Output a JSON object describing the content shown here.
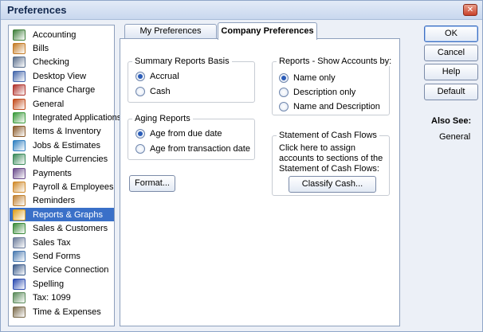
{
  "window": {
    "title": "Preferences",
    "close_label": "✕"
  },
  "categories": [
    {
      "label": "Accounting",
      "icon": "accounting-icon",
      "color": "#3f7f3a"
    },
    {
      "label": "Bills",
      "icon": "bills-icon",
      "color": "#c47b25"
    },
    {
      "label": "Checking",
      "icon": "checking-icon",
      "color": "#5a6f8c"
    },
    {
      "label": "Desktop View",
      "icon": "desktop-view-icon",
      "color": "#4466aa"
    },
    {
      "label": "Finance Charge",
      "icon": "finance-charge-icon",
      "color": "#b0322b"
    },
    {
      "label": "General",
      "icon": "general-icon",
      "color": "#c24a1a"
    },
    {
      "label": "Integrated Applications",
      "icon": "integrated-apps-icon",
      "color": "#3a9a3a"
    },
    {
      "label": "Items & Inventory",
      "icon": "items-inventory-icon",
      "color": "#8a5a2a"
    },
    {
      "label": "Jobs & Estimates",
      "icon": "jobs-estimates-icon",
      "color": "#2f7fc0"
    },
    {
      "label": "Multiple Currencies",
      "icon": "currencies-icon",
      "color": "#3a8a5a"
    },
    {
      "label": "Payments",
      "icon": "payments-icon",
      "color": "#6a4a8a"
    },
    {
      "label": "Payroll & Employees",
      "icon": "payroll-icon",
      "color": "#d08a2a"
    },
    {
      "label": "Reminders",
      "icon": "reminders-icon",
      "color": "#c08030"
    },
    {
      "label": "Reports & Graphs",
      "icon": "reports-graphs-icon",
      "color": "#e0a020",
      "selected": true
    },
    {
      "label": "Sales & Customers",
      "icon": "sales-customers-icon",
      "color": "#3a8a3a"
    },
    {
      "label": "Sales Tax",
      "icon": "sales-tax-icon",
      "color": "#6a7a9a"
    },
    {
      "label": "Send Forms",
      "icon": "send-forms-icon",
      "color": "#4a7ab0"
    },
    {
      "label": "Service Connection",
      "icon": "service-connection-icon",
      "color": "#3a5a8a"
    },
    {
      "label": "Spelling",
      "icon": "spelling-icon",
      "color": "#2a4ab0"
    },
    {
      "label": "Tax: 1099",
      "icon": "tax-1099-icon",
      "color": "#5a8a5a"
    },
    {
      "label": "Time & Expenses",
      "icon": "time-expenses-icon",
      "color": "#7a6a4a"
    }
  ],
  "tabs": {
    "my": "My Preferences",
    "company": "Company Preferences"
  },
  "summary": {
    "title": "Summary Reports Basis",
    "options": [
      "Accrual",
      "Cash"
    ],
    "selected": 0
  },
  "aging": {
    "title": "Aging Reports",
    "options": [
      "Age from due date",
      "Age from transaction date"
    ],
    "selected": 0
  },
  "show_accounts": {
    "title": "Reports - Show Accounts by:",
    "options": [
      "Name only",
      "Description only",
      "Name and Description"
    ],
    "selected": 0
  },
  "cash_flows": {
    "title": "Statement of Cash Flows",
    "text": "Click here to assign accounts to sections of the Statement of Cash Flows:",
    "button": "Classify Cash..."
  },
  "format_button": "Format...",
  "side_buttons": {
    "ok": "OK",
    "cancel": "Cancel",
    "help": "Help",
    "default": "Default"
  },
  "also_see": {
    "title": "Also See:",
    "link": "General"
  }
}
